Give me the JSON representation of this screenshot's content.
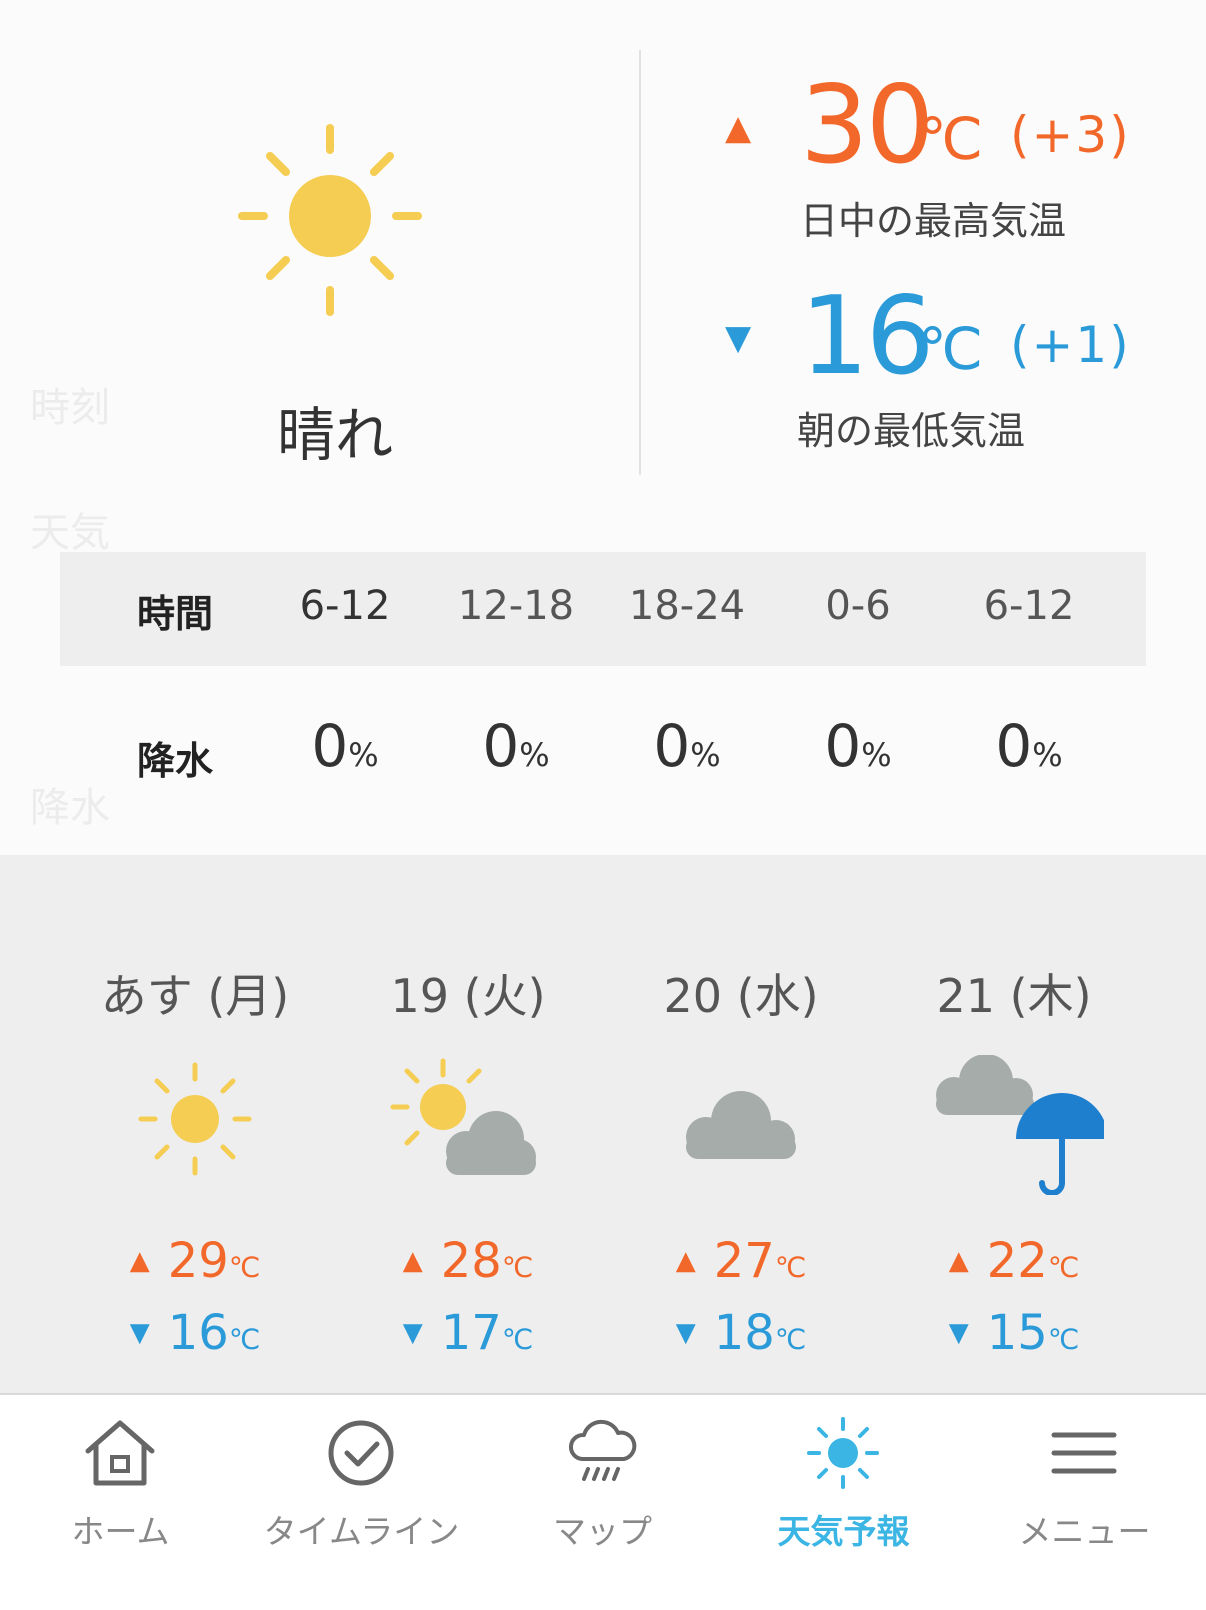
{
  "today": {
    "condition": "晴れ",
    "condition_icon": "sun-icon",
    "high": {
      "value": "30",
      "unit": "℃",
      "diff": "(+3)",
      "caption": "日中の最高気温"
    },
    "low": {
      "value": "16",
      "unit": "℃",
      "diff": "(+1)",
      "caption": "朝の最低気温"
    },
    "precip_table": {
      "time_label": "時間",
      "precip_label": "降水",
      "unit": "%",
      "periods": [
        "6-12",
        "12-18",
        "18-24",
        "0-6",
        "6-12"
      ],
      "values": [
        "0",
        "0",
        "0",
        "0",
        "0"
      ]
    }
  },
  "weekly": [
    {
      "label": "あす (月)",
      "icon": "sun-icon",
      "high": "29",
      "low": "16",
      "unit": "℃"
    },
    {
      "label": "19 (火)",
      "icon": "sun-cloud-icon",
      "high": "28",
      "low": "17",
      "unit": "℃"
    },
    {
      "label": "20 (水)",
      "icon": "cloud-icon",
      "high": "27",
      "low": "18",
      "unit": "℃"
    },
    {
      "label": "21 (木)",
      "icon": "cloud-umbrella-icon",
      "high": "22",
      "low": "15",
      "unit": "℃"
    }
  ],
  "tabs": [
    {
      "label": "ホーム",
      "icon": "home-icon"
    },
    {
      "label": "タイムライン",
      "icon": "check-circle-icon"
    },
    {
      "label": "マップ",
      "icon": "rain-cloud-icon"
    },
    {
      "label": "天気予報",
      "icon": "sun-tab-icon",
      "active": true
    },
    {
      "label": "メニュー",
      "icon": "hamburger-icon"
    }
  ],
  "colors": {
    "high": "#f2682a",
    "low": "#2b9ad8",
    "sun": "#f4cd52",
    "cloud": "#a5aca9",
    "umbrella": "#1e7fcf",
    "active_tab": "#3bb5e3"
  }
}
